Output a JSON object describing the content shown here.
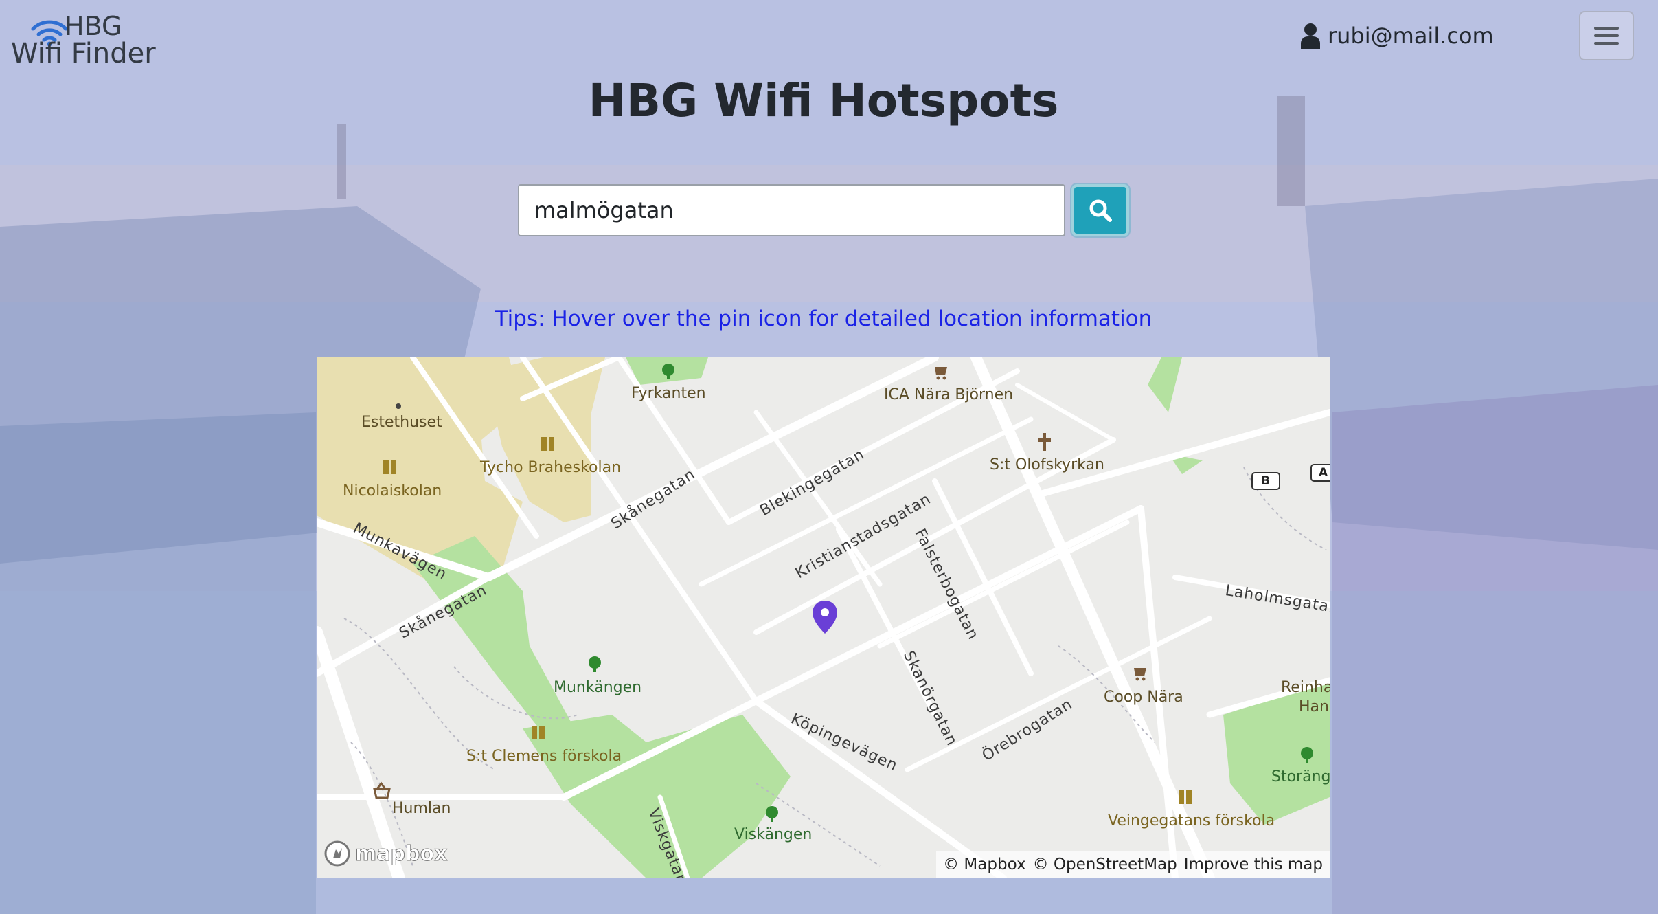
{
  "header": {
    "logo": {
      "line1": "HBG",
      "line2": "Wifi Finder",
      "icon": "wifi-icon"
    },
    "user": {
      "icon": "user-icon",
      "email": "rubi@mail.com"
    },
    "menu": {
      "icon": "hamburger-menu-icon"
    }
  },
  "main": {
    "title": "HBG Wifi Hotspots",
    "search": {
      "value": "malmögatan",
      "button_icon": "search-icon"
    },
    "tips": "Tips: Hover over the pin icon for detailed location information"
  },
  "map": {
    "labels": {
      "fyrkanten": "Fyrkanten",
      "ica": "ICA Nära Björnen",
      "estethuset": "Estethuset",
      "tycho": "Tycho Braheskolan",
      "nicolai": "Nicolaiskolan",
      "olofskyrkan": "S:t Olofskyrkan",
      "skanegatan1": "Skånegatan",
      "skanegatan2": "Skånegatan",
      "blekingegatan": "Blekingegatan",
      "kristianstadsgatan": "Kristianstadsgatan",
      "falsterbogatan": "Falsterbogatan",
      "munkavagen": "Munkavägen",
      "laholmsgatan": "Laholmsgatan",
      "munkangen": "Munkängen",
      "skanorgatan": "Skanörgatan",
      "coop": "Coop Nära",
      "reinha1": "Reinha",
      "reinha2": "Hanc",
      "clemens": "S:t Clemens förskola",
      "kopingevagen": "Köpingevägen",
      "orebrogatan": "Örebrogatan",
      "storang": "Storäng",
      "humlan": "Humlan",
      "viskangen": "Viskängen",
      "viskgatan": "Viskgatan",
      "veingegatans": "Veingegatans förskola",
      "shield_b": "B",
      "shield_a": "A"
    },
    "logo_text": "mapbox",
    "attribution": {
      "mapbox": "© Mapbox",
      "osm": "© OpenStreetMap",
      "improve": "Improve this map"
    },
    "pin_icon": "map-pin-icon"
  },
  "colors": {
    "accent": "#1fa1b9",
    "tips": "#1a22e6",
    "pin": "#6a3fd6",
    "park": "#b4e1a0",
    "school_area": "#e8dfb0"
  }
}
